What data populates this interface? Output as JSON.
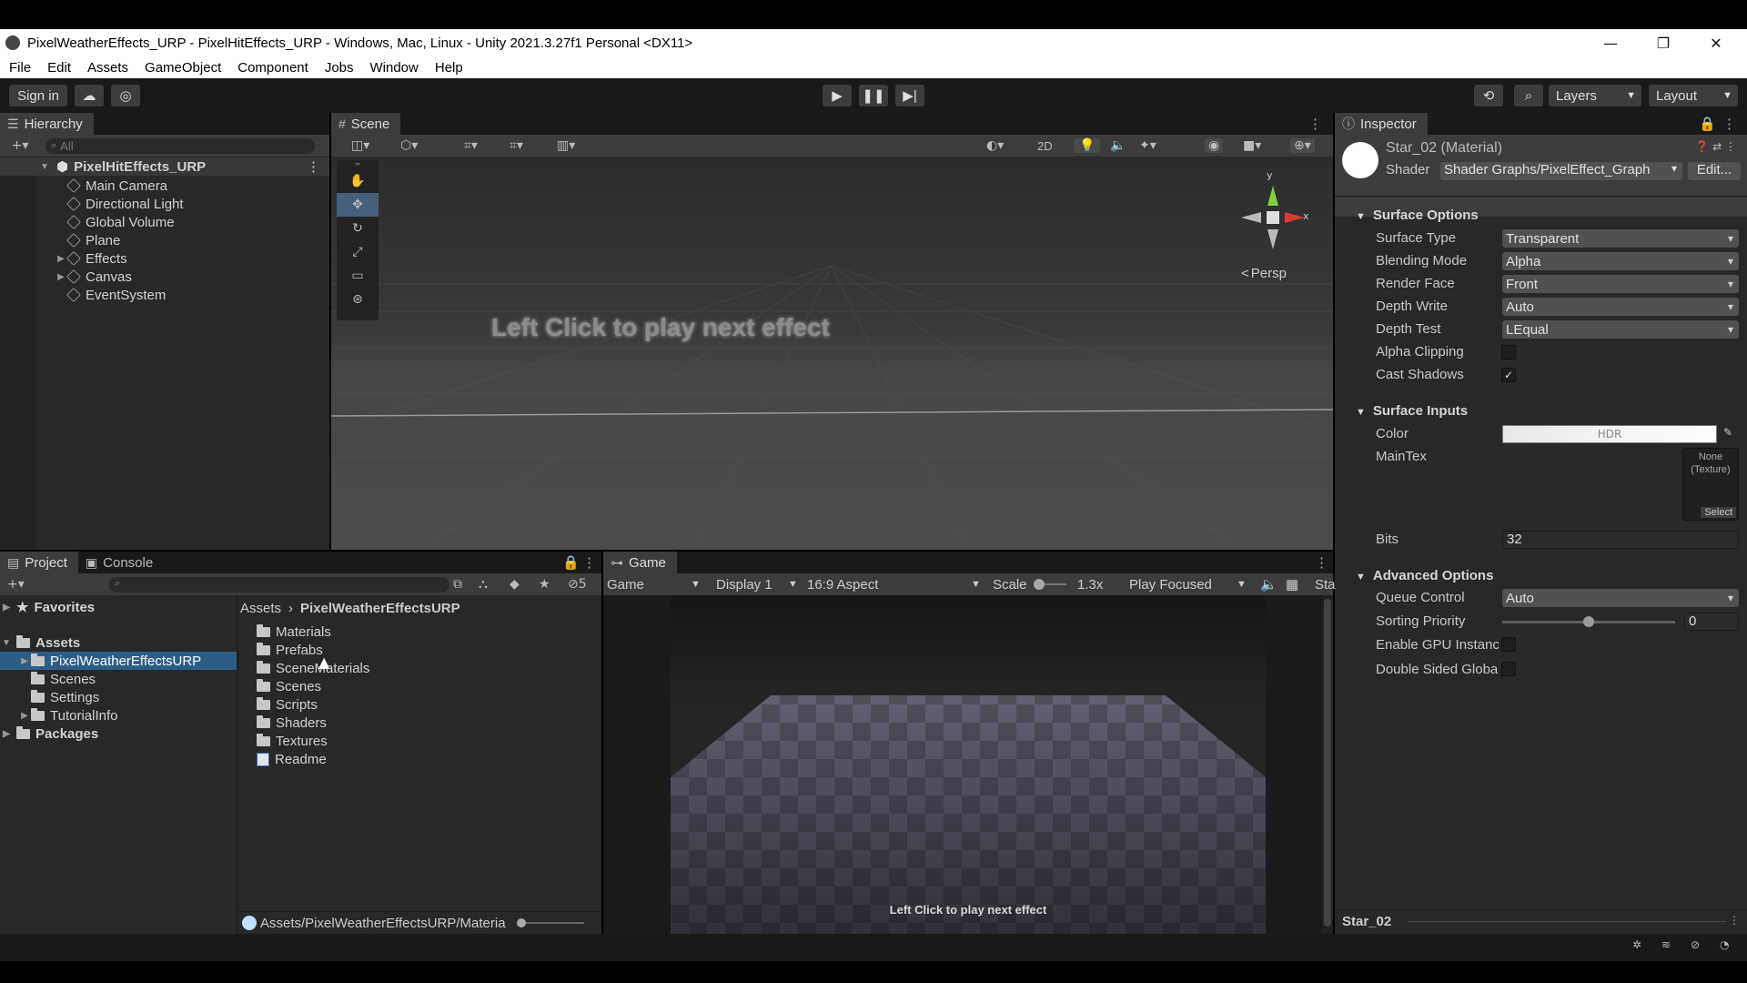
{
  "window": {
    "title": "PixelWeatherEffects_URP - PixelHitEffects_URP - Windows, Mac, Linux - Unity 2021.3.27f1 Personal <DX11>",
    "minimize": "—",
    "restore": "❐",
    "close": "✕"
  },
  "menu": [
    "File",
    "Edit",
    "Assets",
    "GameObject",
    "Component",
    "Jobs",
    "Window",
    "Help"
  ],
  "toolbar": {
    "sign_in": "Sign in",
    "layers": "Layers",
    "layout": "Layout"
  },
  "hierarchy": {
    "tab": "Hierarchy",
    "search_placeholder": "All",
    "scene": "PixelHitEffects_URP",
    "items": [
      {
        "label": "Main Camera",
        "expandable": false
      },
      {
        "label": "Directional Light",
        "expandable": false
      },
      {
        "label": "Global Volume",
        "expandable": false
      },
      {
        "label": "Plane",
        "expandable": false
      },
      {
        "label": "Effects",
        "expandable": true
      },
      {
        "label": "Canvas",
        "expandable": true
      },
      {
        "label": "EventSystem",
        "expandable": false
      }
    ]
  },
  "scene": {
    "tab": "Scene",
    "overlay_text": "Left Click to play next effect",
    "persp_label": "Persp",
    "mode_2d": "2D",
    "gizmo_y": "y",
    "gizmo_x": "x"
  },
  "project": {
    "tab_project": "Project",
    "tab_console": "Console",
    "hidden_count": "5",
    "favorites": "Favorites",
    "assets": "Assets",
    "tree": [
      "PixelWeatherEffectsURP",
      "Scenes",
      "Settings",
      "TutorialInfo"
    ],
    "packages": "Packages",
    "breadcrumb_root": "Assets",
    "breadcrumb_current": "PixelWeatherEffectsURP",
    "files": [
      "Materials",
      "Prefabs",
      "SceneMaterials",
      "Scenes",
      "Scripts",
      "Shaders",
      "Textures",
      "Readme"
    ],
    "status_path": "Assets/PixelWeatherEffectsURP/Materia"
  },
  "game": {
    "tab": "Game",
    "mode": "Game",
    "display": "Display 1",
    "aspect": "16:9 Aspect",
    "scale_label": "Scale",
    "scale_value": "1.3x",
    "play_focused": "Play Focused",
    "stats": "Sta",
    "overlay_text": "Left Click to play next effect"
  },
  "inspector": {
    "tab": "Inspector",
    "object_name": "Star_02 (Material)",
    "shader_label": "Shader",
    "shader_value": "Shader Graphs/PixelEffect_Graph",
    "edit_button": "Edit...",
    "surface_options": "Surface Options",
    "surface_type_label": "Surface Type",
    "surface_type": "Transparent",
    "blending_label": "Blending Mode",
    "blending": "Alpha",
    "render_face_label": "Render Face",
    "render_face": "Front",
    "depth_write_label": "Depth Write",
    "depth_write": "Auto",
    "depth_test_label": "Depth Test",
    "depth_test": "LEqual",
    "alpha_clip_label": "Alpha Clipping",
    "alpha_clipping": false,
    "cast_shadows_label": "Cast Shadows",
    "cast_shadows": true,
    "surface_inputs": "Surface Inputs",
    "color_label": "Color",
    "color_hdr": "HDR",
    "maintex_label": "MainTex",
    "maintex_none": "None (Texture)",
    "maintex_select": "Select",
    "bits_label": "Bits",
    "bits": "32",
    "advanced_options": "Advanced Options",
    "queue_control_label": "Queue Control",
    "queue_control": "Auto",
    "sorting_priority_label": "Sorting Priority",
    "sorting_priority": "0",
    "sorting_priority_slider": 0.5,
    "gpu_instancing_label": "Enable GPU Instanc",
    "double_sided_label": "Double Sided Globa",
    "footer_name": "Star_02"
  }
}
